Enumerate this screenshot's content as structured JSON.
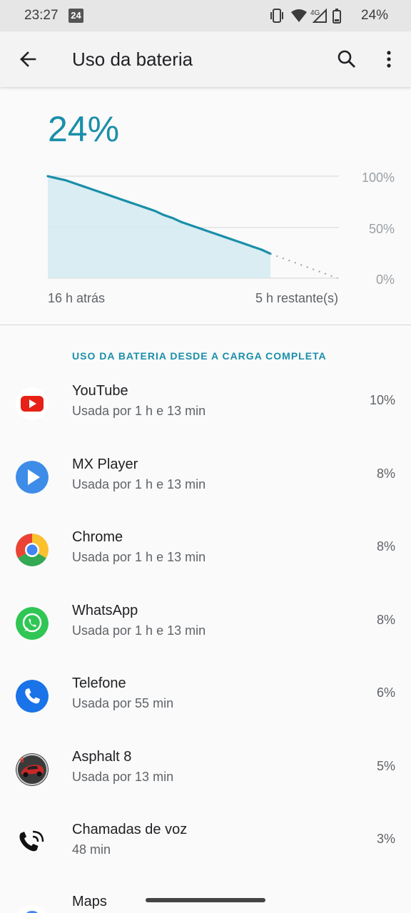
{
  "status_bar": {
    "time": "23:27",
    "calendar_badge": "24",
    "network": "4G",
    "battery": "24%"
  },
  "app_bar": {
    "title": "Uso da bateria"
  },
  "battery_level": "24%",
  "chart": {
    "y_tick_labels": [
      "100%",
      "50%",
      "0%"
    ],
    "x_left_label": "16 h atrás",
    "x_right_label": "5 h restante(s)",
    "history_percent": [
      100,
      98,
      96,
      93,
      90,
      87,
      84,
      81,
      78,
      75,
      72,
      69,
      66,
      62,
      59,
      55,
      52,
      49,
      46,
      43,
      40,
      37,
      34,
      31,
      28,
      24
    ],
    "projection_percent": [
      24,
      0
    ],
    "colors": {
      "line": "#1a8fa9",
      "fill": "#d2eaf1",
      "grid": "#d5d5d5"
    }
  },
  "section_label": "USO DA BATERIA DESDE A CARGA COMPLETA",
  "apps": [
    {
      "name": "YouTube",
      "usage": "Usada por 1 h e 13 min",
      "percent": "10%",
      "icon": "youtube-icon"
    },
    {
      "name": "MX Player",
      "usage": "Usada por 1 h e 13 min",
      "percent": "8%",
      "icon": "mx-player-icon"
    },
    {
      "name": "Chrome",
      "usage": "Usada por 1 h e 13 min",
      "percent": "8%",
      "icon": "chrome-icon"
    },
    {
      "name": "WhatsApp",
      "usage": "Usada por 1 h e 13 min",
      "percent": "8%",
      "icon": "whatsapp-icon"
    },
    {
      "name": "Telefone",
      "usage": "Usada por 55 min",
      "percent": "6%",
      "icon": "phone-icon"
    },
    {
      "name": "Asphalt 8",
      "usage": "Usada por 13 min",
      "percent": "5%",
      "icon": "asphalt-icon"
    },
    {
      "name": "Chamadas de voz",
      "usage": "48 min",
      "percent": "3%",
      "icon": "voice-call-icon"
    },
    {
      "name": "Maps",
      "usage": "",
      "percent": "",
      "icon": "maps-icon"
    }
  ]
}
